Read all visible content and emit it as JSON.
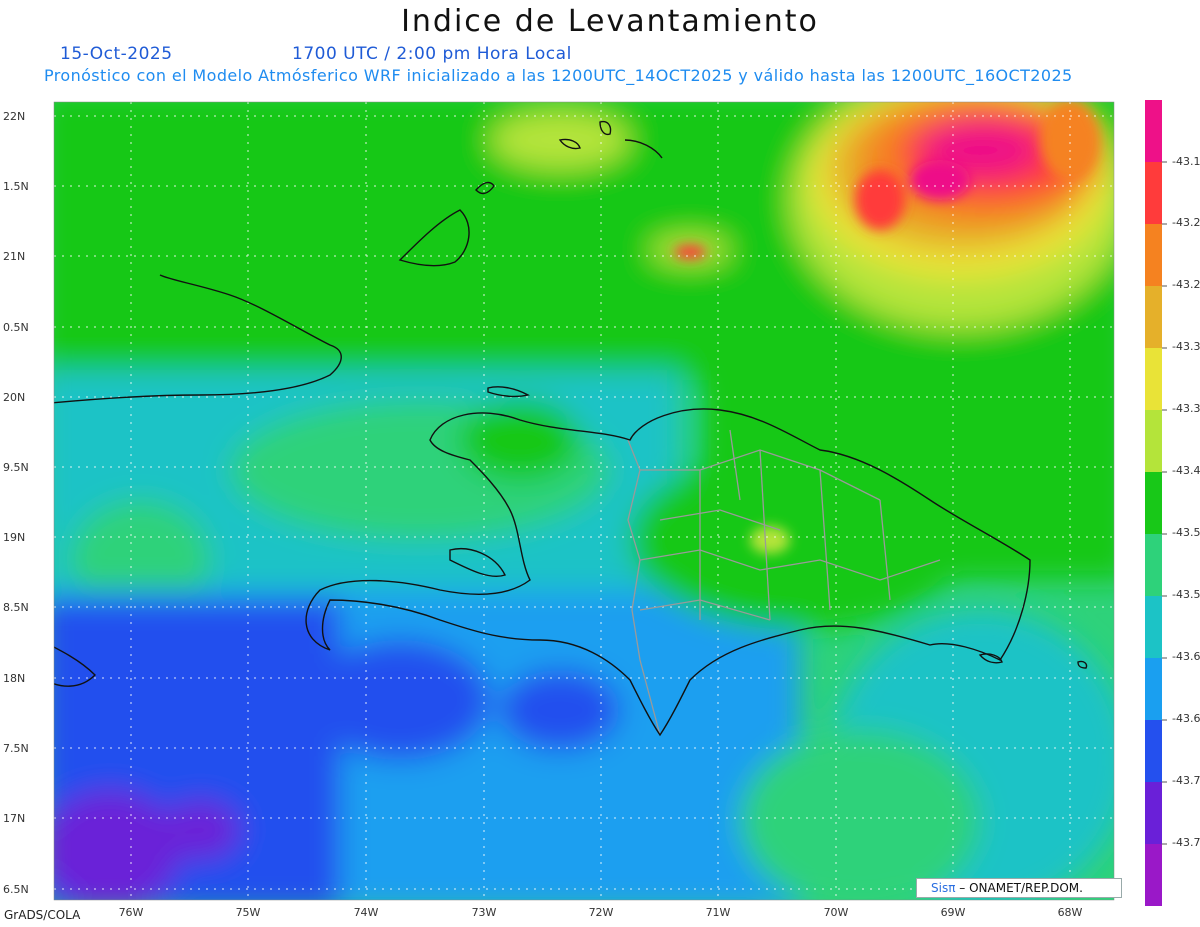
{
  "header": {
    "title": "Indice de Levantamiento",
    "date": "15-Oct-2025",
    "time": "1700 UTC / 2:00 pm Hora Local",
    "subtitle": "Pronóstico con el Modelo Atmósferico WRF inicializado a las 1200UTC_14OCT2025 y válido hasta las  1200UTC_16OCT2025"
  },
  "map": {
    "lat_labels": [
      "22N",
      "1.5N",
      "21N",
      "0.5N",
      "20N",
      "9.5N",
      "19N",
      "8.5N",
      "18N",
      "7.5N",
      "17N",
      "6.5N"
    ],
    "lon_labels": [
      "76W",
      "75W",
      "74W",
      "73W",
      "72W",
      "71W",
      "70W",
      "69W",
      "68W"
    ],
    "grid": true,
    "colors": {
      "land_outline": "#111111",
      "province_borders": "#9a9a9a",
      "gridlines": "#ffffff"
    }
  },
  "colorbar": {
    "labels": [
      "-43.1",
      "-43.2",
      "-43.2",
      "-43.3",
      "-43.3",
      "-43.4",
      "-43.5",
      "-43.5",
      "-43.6",
      "-43.6",
      "-43.7",
      "-43.7"
    ],
    "colors": [
      "#ee1188",
      "#ff3b3b",
      "#f58220",
      "#e5b02a",
      "#e9e337",
      "#b4e43a",
      "#18c818",
      "#2ed27a",
      "#1cc3c6",
      "#1a9ff0",
      "#2450ee",
      "#6a20d8",
      "#9a18c8"
    ]
  },
  "footer": {
    "left": "GrADS/COLA",
    "credit_logo": "Sisπ",
    "credit_text": "– ONAMET/REP.DOM."
  }
}
